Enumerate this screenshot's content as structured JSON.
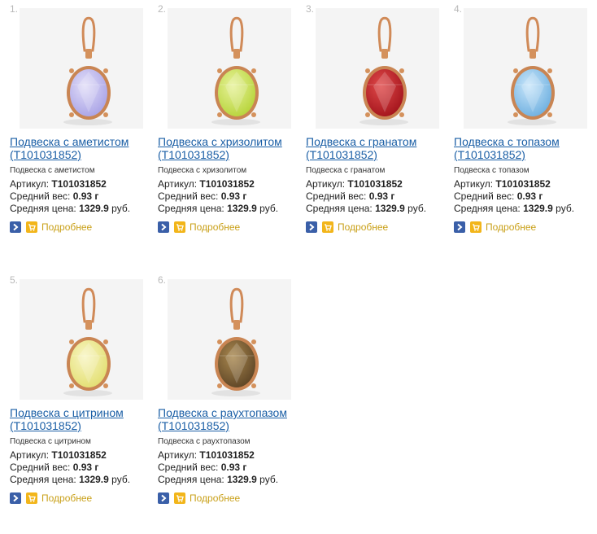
{
  "labels": {
    "article": "Артикул:",
    "weight": "Средний вес:",
    "price": "Средняя цена:",
    "currency": "руб.",
    "more": "Подробнее"
  },
  "products": [
    {
      "num": "1.",
      "title": "Подвеска с аметистом (T101031852)",
      "subtitle": "Подвеска с аметистом",
      "article": "T101031852",
      "weight": "0.93 г",
      "price": "1329.9",
      "stone_color": "#a9a3e6",
      "stone_light": "#e2def8"
    },
    {
      "num": "2.",
      "title": "Подвеска с хризолитом (T101031852)",
      "subtitle": "Подвеска с хризолитом",
      "article": "T101031852",
      "weight": "0.93 г",
      "price": "1329.9",
      "stone_color": "#b7d43a",
      "stone_light": "#e7f29a"
    },
    {
      "num": "3.",
      "title": "Подвеска с гранатом (T101031852)",
      "subtitle": "Подвеска с гранатом",
      "article": "T101031852",
      "weight": "0.93 г",
      "price": "1329.9",
      "stone_color": "#a3141c",
      "stone_light": "#e04a4a"
    },
    {
      "num": "4.",
      "title": "Подвеска с топазом (T101031852)",
      "subtitle": "Подвеска с топазом",
      "article": "T101031852",
      "weight": "0.93 г",
      "price": "1329.9",
      "stone_color": "#6fb0e0",
      "stone_light": "#c9e6fa"
    },
    {
      "num": "5.",
      "title": "Подвеска с цитрином (T101031852)",
      "subtitle": "Подвеска с цитрином",
      "article": "T101031852",
      "weight": "0.93 г",
      "price": "1329.9",
      "stone_color": "#e3df72",
      "stone_light": "#f8f5c2"
    },
    {
      "num": "6.",
      "title": "Подвеска с раухтопазом (T101031852)",
      "subtitle": "Подвеска с раухтопазом",
      "article": "T101031852",
      "weight": "0.93 г",
      "price": "1329.9",
      "stone_color": "#5e4526",
      "stone_light": "#a9884f"
    }
  ]
}
